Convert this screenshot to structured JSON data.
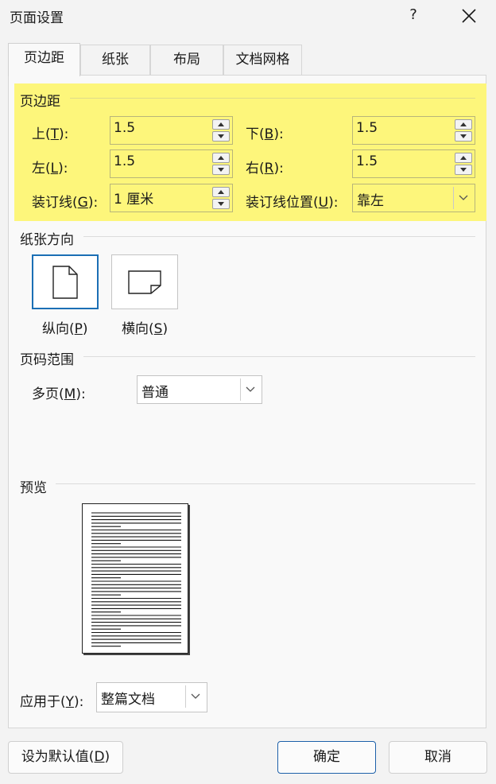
{
  "window": {
    "title": "页面设置",
    "help": "?"
  },
  "tabs": [
    {
      "label": "页边距",
      "active": true
    },
    {
      "label": "纸张",
      "active": false
    },
    {
      "label": "布局",
      "active": false
    },
    {
      "label": "文档网格",
      "active": false
    }
  ],
  "margins": {
    "group_title": "页边距",
    "top": {
      "label_pre": "上(",
      "key": "T",
      "label_post": "):",
      "value": "1.5"
    },
    "bottom": {
      "label_pre": "下(",
      "key": "B",
      "label_post": "):",
      "value": "1.5"
    },
    "left": {
      "label_pre": "左(",
      "key": "L",
      "label_post": "):",
      "value": "1.5"
    },
    "right": {
      "label_pre": "右(",
      "key": "R",
      "label_post": "):",
      "value": "1.5"
    },
    "gutter": {
      "label_pre": "装订线(",
      "key": "G",
      "label_post": "):",
      "value": "1 厘米"
    },
    "gutter_position": {
      "label_pre": "装订线位置(",
      "key": "U",
      "label_post": "):",
      "value": "靠左"
    }
  },
  "orientation": {
    "group_title": "纸张方向",
    "portrait": {
      "label_pre": "纵向(",
      "key": "P",
      "label_post": ")",
      "selected": true
    },
    "landscape": {
      "label_pre": "横向(",
      "key": "S",
      "label_post": ")",
      "selected": false
    }
  },
  "pages": {
    "group_title": "页码范围",
    "multiple": {
      "label_pre": "多页(",
      "key": "M",
      "label_post": "):",
      "value": "普通"
    }
  },
  "preview": {
    "group_title": "预览"
  },
  "apply_to": {
    "label_pre": "应用于(",
    "key": "Y",
    "label_post": "):",
    "value": "整篇文档"
  },
  "buttons": {
    "set_default": {
      "label_pre": "设为默认值(",
      "key": "D",
      "label_post": ")"
    },
    "ok": "确定",
    "cancel": "取消"
  },
  "colors": {
    "highlight": "#fdf67b",
    "accent": "#1b6fb5"
  }
}
